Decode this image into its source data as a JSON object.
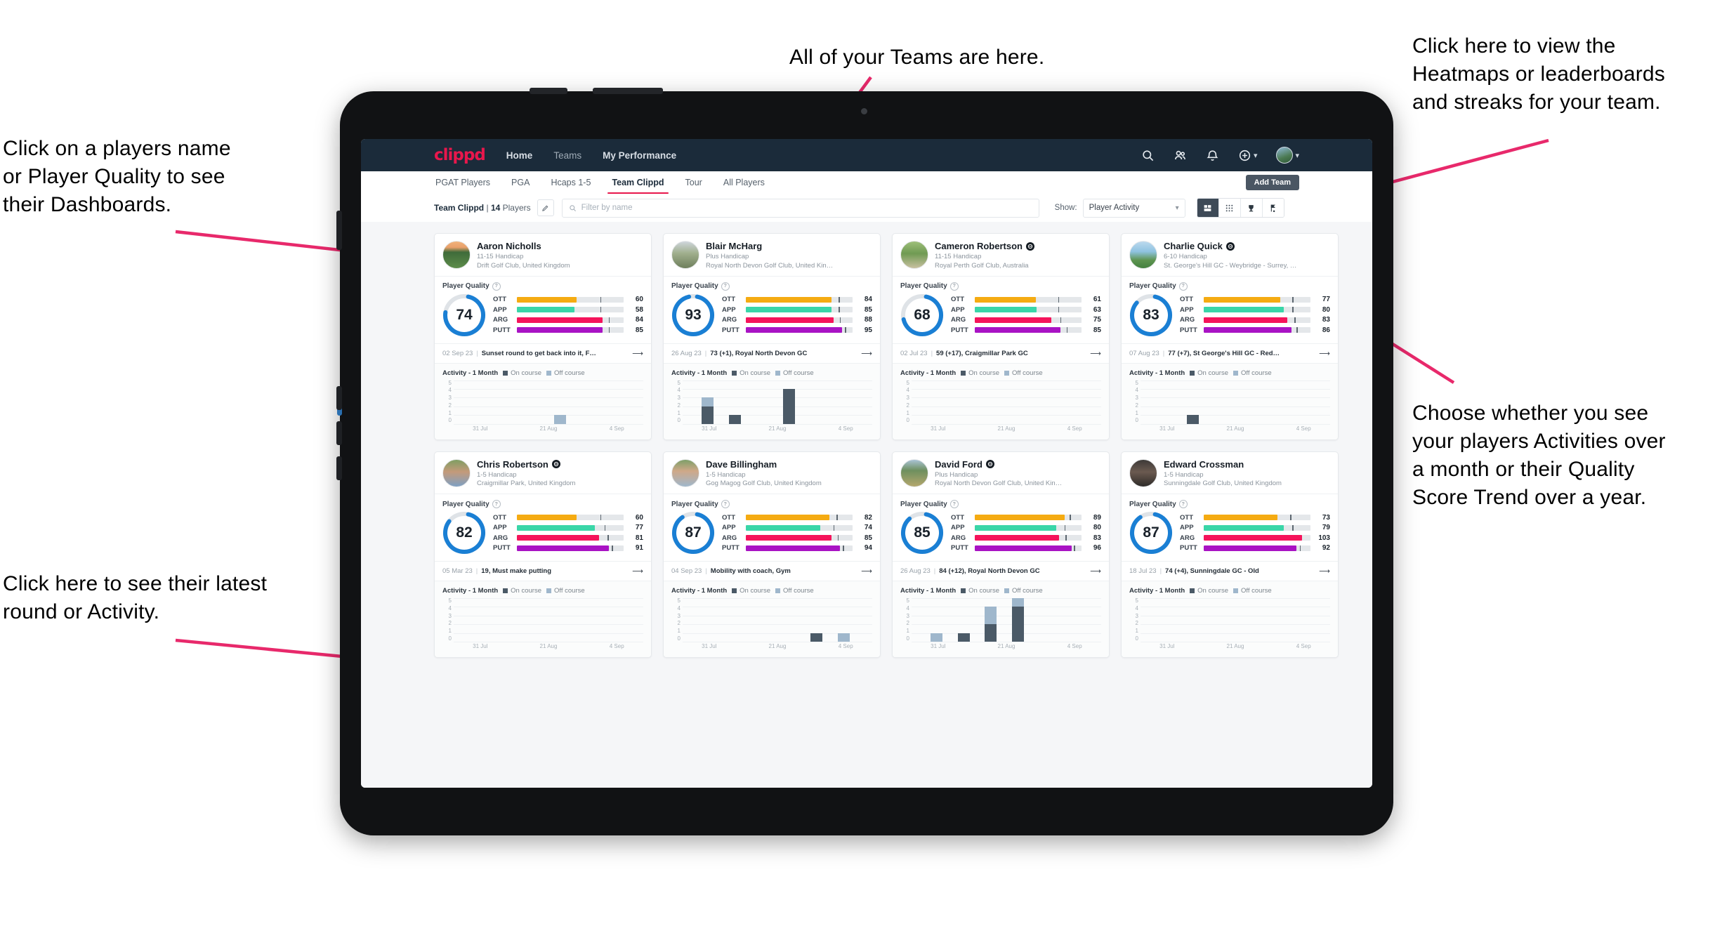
{
  "annotations": [
    {
      "id": "teams",
      "text": "All of your Teams are here."
    },
    {
      "id": "heatmaps",
      "text": "Click here to view the\nHeatmaps or leaderboards\nand streaks for your team."
    },
    {
      "id": "players-name",
      "text": "Click on a players name\nor Player Quality to see\ntheir Dashboards."
    },
    {
      "id": "activity-quality",
      "text": "Choose whether you see\nyour players Activities over\na month or their Quality\nScore Trend over a year."
    },
    {
      "id": "latest-round",
      "text": "Click here to see their latest\nround or Activity."
    }
  ],
  "colors": {
    "brand_pink": "#e8174c",
    "appbar": "#1b2b3a",
    "ott": "#f5ab12",
    "app": "#3ad6a8",
    "arg": "#f5145b",
    "putt": "#a913c4",
    "ring": "#1a7fd4",
    "on_course": "#4b5a67",
    "off_course": "#9fb7cc"
  },
  "app": {
    "logo": "clippd",
    "nav": [
      {
        "label": "Home",
        "active": true
      },
      {
        "label": "Teams",
        "active": false
      },
      {
        "label": "My Performance",
        "active": true
      }
    ],
    "icons": [
      "search-icon",
      "people-icon",
      "bell-icon",
      "plus-circle-icon",
      "avatar"
    ],
    "tabs": [
      {
        "label": "PGAT Players",
        "active": false
      },
      {
        "label": "PGA",
        "active": false
      },
      {
        "label": "Hcaps 1-5",
        "active": false
      },
      {
        "label": "Team Clippd",
        "active": true
      },
      {
        "label": "Tour",
        "active": false
      },
      {
        "label": "All Players",
        "active": false
      }
    ],
    "add_team_label": "Add Team",
    "toolbar": {
      "team_name": "Team Clippd",
      "separator": "|",
      "player_count": "14",
      "players_word": "Players",
      "edit_icon": "pencil-icon",
      "search_placeholder": "Filter by name",
      "show_label": "Show:",
      "show_value": "Player Activity",
      "view_buttons": [
        "grid-view-icon",
        "dots-grid-icon",
        "trophy-icon",
        "flag-icon"
      ]
    }
  },
  "card_labels": {
    "player_quality": "Player Quality",
    "activity_title": "Activity - 1 Month",
    "legend_on": "On course",
    "legend_off": "Off course",
    "metric_labels": [
      "OTT",
      "APP",
      "ARG",
      "PUTT"
    ],
    "y_ticks": [
      "5",
      "4",
      "3",
      "2",
      "1",
      "0"
    ],
    "x_ticks": [
      "31 Jul",
      "21 Aug",
      "4 Sep"
    ]
  },
  "players": [
    {
      "name": "Aaron Nicholls",
      "verified": false,
      "handicap": "11-15 Handicap",
      "club": "Drift Golf Club, United Kingdom",
      "quality": 74,
      "metrics": [
        {
          "label": "OTT",
          "value": 60,
          "fill": 56,
          "tick": 78
        },
        {
          "label": "APP",
          "value": 58,
          "fill": 54,
          "tick": 78
        },
        {
          "label": "ARG",
          "value": 84,
          "fill": 80,
          "tick": 86
        },
        {
          "label": "PUTT",
          "value": 85,
          "fill": 80,
          "tick": 86
        }
      ],
      "last_date": "02 Sep 23",
      "last_desc": "Sunset round to get back into it, F…",
      "avatar": "course-sunset",
      "chart_data": {
        "type": "bar",
        "title": "Activity - 1 Month",
        "categories": [
          "31 Jul",
          "21 Aug",
          "4 Sep"
        ],
        "ylim": [
          0,
          5
        ],
        "series": [
          {
            "name": "On course",
            "values": [
              0,
              0,
              0,
              0,
              0,
              0
            ]
          },
          {
            "name": "Off course",
            "values": [
              0,
              0,
              0,
              1,
              0,
              0
            ]
          }
        ]
      }
    },
    {
      "name": "Blair McHarg",
      "verified": false,
      "handicap": "Plus Handicap",
      "club": "Royal North Devon Golf Club, United Kin…",
      "quality": 93,
      "metrics": [
        {
          "label": "OTT",
          "value": 84,
          "fill": 80,
          "tick": 87
        },
        {
          "label": "APP",
          "value": 85,
          "fill": 80,
          "tick": 87
        },
        {
          "label": "ARG",
          "value": 88,
          "fill": 82,
          "tick": 88
        },
        {
          "label": "PUTT",
          "value": 95,
          "fill": 90,
          "tick": 93
        }
      ],
      "last_date": "26 Aug 23",
      "last_desc": "73 (+1), Royal North Devon GC",
      "avatar": "golfer-links",
      "chart_data": {
        "type": "bar",
        "title": "Activity - 1 Month",
        "categories": [
          "31 Jul",
          "21 Aug",
          "4 Sep"
        ],
        "ylim": [
          0,
          5
        ],
        "series": [
          {
            "name": "On course",
            "values": [
              2,
              1,
              0,
              4,
              0,
              0
            ]
          },
          {
            "name": "Off course",
            "values": [
              1,
              0,
              0,
              0,
              0,
              0
            ]
          }
        ]
      }
    },
    {
      "name": "Cameron Robertson",
      "verified": true,
      "handicap": "11-15 Handicap",
      "club": "Royal Perth Golf Club, Australia",
      "quality": 68,
      "metrics": [
        {
          "label": "OTT",
          "value": 61,
          "fill": 57,
          "tick": 78
        },
        {
          "label": "APP",
          "value": 63,
          "fill": 58,
          "tick": 78
        },
        {
          "label": "ARG",
          "value": 75,
          "fill": 72,
          "tick": 80
        },
        {
          "label": "PUTT",
          "value": 85,
          "fill": 80,
          "tick": 86
        }
      ],
      "last_date": "02 Jul 23",
      "last_desc": "59 (+17), Craigmillar Park GC",
      "avatar": "golfer-path",
      "chart_data": {
        "type": "bar",
        "title": "Activity - 1 Month",
        "categories": [
          "31 Jul",
          "21 Aug",
          "4 Sep"
        ],
        "ylim": [
          0,
          5
        ],
        "series": [
          {
            "name": "On course",
            "values": [
              0,
              0,
              0,
              0,
              0,
              0
            ]
          },
          {
            "name": "Off course",
            "values": [
              0,
              0,
              0,
              0,
              0,
              0
            ]
          }
        ]
      }
    },
    {
      "name": "Charlie Quick",
      "verified": true,
      "handicap": "6-10 Handicap",
      "club": "St. George's Hill GC - Weybridge - Surrey, …",
      "quality": 83,
      "metrics": [
        {
          "label": "OTT",
          "value": 77,
          "fill": 72,
          "tick": 83
        },
        {
          "label": "APP",
          "value": 80,
          "fill": 75,
          "tick": 83
        },
        {
          "label": "ARG",
          "value": 83,
          "fill": 78,
          "tick": 85
        },
        {
          "label": "PUTT",
          "value": 86,
          "fill": 82,
          "tick": 87
        }
      ],
      "last_date": "07 Aug 23",
      "last_desc": "77 (+7), St George's Hill GC - Red…",
      "avatar": "fairway-sky",
      "chart_data": {
        "type": "bar",
        "title": "Activity - 1 Month",
        "categories": [
          "31 Jul",
          "21 Aug",
          "4 Sep"
        ],
        "ylim": [
          0,
          5
        ],
        "series": [
          {
            "name": "On course",
            "values": [
              0,
              1,
              0,
              0,
              0,
              0
            ]
          },
          {
            "name": "Off course",
            "values": [
              0,
              0,
              0,
              0,
              0,
              0
            ]
          }
        ]
      }
    },
    {
      "name": "Chris Robertson",
      "verified": true,
      "handicap": "1-5 Handicap",
      "club": "Craigmillar Park, United Kingdom",
      "quality": 82,
      "metrics": [
        {
          "label": "OTT",
          "value": 60,
          "fill": 56,
          "tick": 78
        },
        {
          "label": "APP",
          "value": 77,
          "fill": 73,
          "tick": 82
        },
        {
          "label": "ARG",
          "value": 81,
          "fill": 77,
          "tick": 85
        },
        {
          "label": "PUTT",
          "value": 91,
          "fill": 86,
          "tick": 89
        }
      ],
      "last_date": "05 Mar 23",
      "last_desc": "19, Must make putting",
      "avatar": "man-glasses",
      "chart_data": {
        "type": "bar",
        "title": "Activity - 1 Month",
        "categories": [
          "31 Jul",
          "21 Aug",
          "4 Sep"
        ],
        "ylim": [
          0,
          5
        ],
        "series": [
          {
            "name": "On course",
            "values": [
              0,
              0,
              0,
              0,
              0,
              0
            ]
          },
          {
            "name": "Off course",
            "values": [
              0,
              0,
              0,
              0,
              0,
              0
            ]
          }
        ]
      }
    },
    {
      "name": "Dave Billingham",
      "verified": false,
      "handicap": "1-5 Handicap",
      "club": "Gog Magog Golf Club, United Kingdom",
      "quality": 87,
      "metrics": [
        {
          "label": "OTT",
          "value": 82,
          "fill": 78,
          "tick": 85
        },
        {
          "label": "APP",
          "value": 74,
          "fill": 70,
          "tick": 82
        },
        {
          "label": "ARG",
          "value": 85,
          "fill": 80,
          "tick": 86
        },
        {
          "label": "PUTT",
          "value": 94,
          "fill": 88,
          "tick": 91
        }
      ],
      "last_date": "04 Sep 23",
      "last_desc": "Mobility with coach, Gym",
      "avatar": "man-beard",
      "chart_data": {
        "type": "bar",
        "title": "Activity - 1 Month",
        "categories": [
          "31 Jul",
          "21 Aug",
          "4 Sep"
        ],
        "ylim": [
          0,
          5
        ],
        "series": [
          {
            "name": "On course",
            "values": [
              0,
              0,
              0,
              0,
              1,
              0
            ]
          },
          {
            "name": "Off course",
            "values": [
              0,
              0,
              0,
              0,
              0,
              1
            ]
          }
        ]
      }
    },
    {
      "name": "David Ford",
      "verified": true,
      "handicap": "Plus Handicap",
      "club": "Royal North Devon Golf Club, United Kin…",
      "quality": 85,
      "metrics": [
        {
          "label": "OTT",
          "value": 89,
          "fill": 84,
          "tick": 89
        },
        {
          "label": "APP",
          "value": 80,
          "fill": 76,
          "tick": 84
        },
        {
          "label": "ARG",
          "value": 83,
          "fill": 79,
          "tick": 85
        },
        {
          "label": "PUTT",
          "value": 96,
          "fill": 91,
          "tick": 93
        }
      ],
      "last_date": "26 Aug 23",
      "last_desc": "84 (+12), Royal North Devon GC",
      "avatar": "golfer-walking",
      "chart_data": {
        "type": "bar",
        "title": "Activity - 1 Month",
        "categories": [
          "31 Jul",
          "21 Aug",
          "4 Sep"
        ],
        "ylim": [
          0,
          5
        ],
        "series": [
          {
            "name": "On course",
            "values": [
              0,
              1,
              2,
              4,
              0,
              0
            ]
          },
          {
            "name": "Off course",
            "values": [
              1,
              0,
              2,
              1,
              0,
              0
            ]
          }
        ]
      }
    },
    {
      "name": "Edward Crossman",
      "verified": false,
      "handicap": "1-5 Handicap",
      "club": "Sunningdale Golf Club, United Kingdom",
      "quality": 87,
      "metrics": [
        {
          "label": "OTT",
          "value": 73,
          "fill": 69,
          "tick": 81
        },
        {
          "label": "APP",
          "value": 79,
          "fill": 75,
          "tick": 83
        },
        {
          "label": "ARG",
          "value": 103,
          "fill": 92,
          "tick": 0
        },
        {
          "label": "PUTT",
          "value": 92,
          "fill": 87,
          "tick": 90
        }
      ],
      "last_date": "18 Jul 23",
      "last_desc": "74 (+4), Sunningdale GC - Old",
      "avatar": "indoor-dark",
      "chart_data": {
        "type": "bar",
        "title": "Activity - 1 Month",
        "categories": [
          "31 Jul",
          "21 Aug",
          "4 Sep"
        ],
        "ylim": [
          0,
          5
        ],
        "series": [
          {
            "name": "On course",
            "values": [
              0,
              0,
              0,
              0,
              0,
              0
            ]
          },
          {
            "name": "Off course",
            "values": [
              0,
              0,
              0,
              0,
              0,
              0
            ]
          }
        ]
      }
    }
  ]
}
